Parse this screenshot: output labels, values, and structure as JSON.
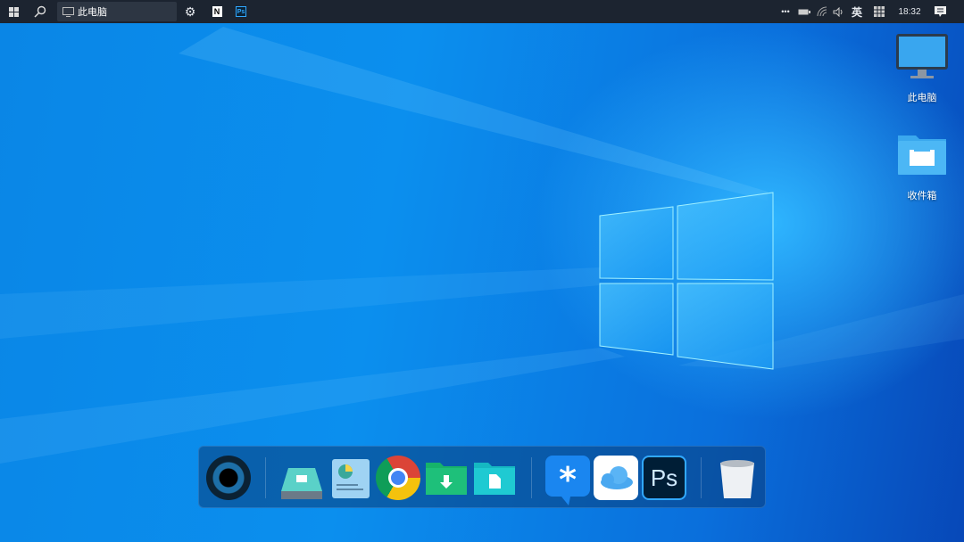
{
  "taskbar": {
    "start_icon": "windows-grid-icon",
    "search_icon": "search-icon",
    "address_label": "此电脑",
    "settings_icon": "gear-icon",
    "notion_label": "N",
    "ps_label": "Ps",
    "tray": {
      "more": "•••",
      "ime": "英",
      "time": "18:32"
    }
  },
  "desktop": {
    "icons": [
      {
        "label": "此电脑"
      },
      {
        "label": "收件箱"
      }
    ]
  },
  "dock": {
    "items": [
      "Launcher",
      "Disk",
      "Statistics",
      "Chrome",
      "Downloads",
      "Documents",
      "DingTalk",
      "iCloud",
      "Photoshop",
      "Trash"
    ],
    "ps_label": "Ps"
  },
  "colors": {
    "taskbar": "#1c2430",
    "accent": "#0a86e6"
  }
}
